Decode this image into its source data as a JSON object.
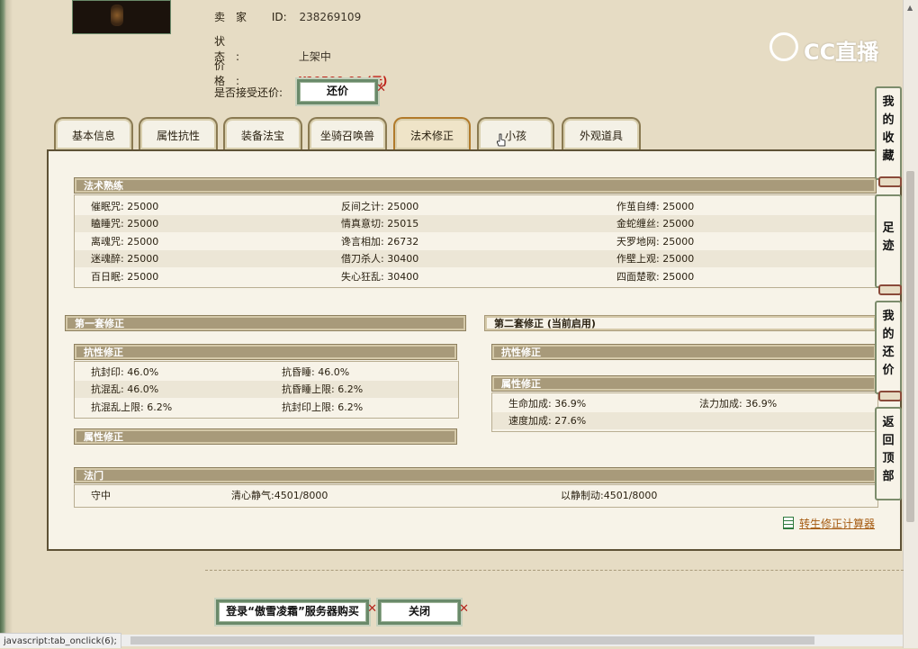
{
  "seller": {
    "seller_label": "卖家",
    "id_label": "ID:",
    "id_value": "238269109",
    "status_label": "状态:",
    "status_value": "上架中",
    "price_label": "价格:",
    "price_value": "¥19500.00 (元)",
    "counter_label": "是否接受还价:",
    "counter_button": "还价"
  },
  "logo": {
    "text": "CC直播"
  },
  "tabs": [
    {
      "label": "基本信息"
    },
    {
      "label": "属性抗性"
    },
    {
      "label": "装备法宝"
    },
    {
      "label": "坐骑召唤兽"
    },
    {
      "label": "法术修正"
    },
    {
      "label": "小孩"
    },
    {
      "label": "外观道具"
    }
  ],
  "spell_mastery": {
    "title": "法术熟练",
    "rows": [
      [
        "催眠咒: 25000",
        "反间之计: 25000",
        "作茧自缚: 25000"
      ],
      [
        "瞌睡咒: 25000",
        "情真意切: 25015",
        "金蛇缠丝: 25000"
      ],
      [
        "离魂咒: 25000",
        "谗言相加: 26732",
        "天罗地网: 25000"
      ],
      [
        "迷魂醉: 25000",
        "借刀杀人: 30400",
        "作壁上观: 25000"
      ],
      [
        "百日眠: 25000",
        "失心狂乱: 30400",
        "四面楚歌: 25000"
      ]
    ]
  },
  "set1": {
    "title": "第一套修正",
    "resist_title": "抗性修正",
    "resist_rows": [
      [
        "抗封印: 46.0%",
        "抗昏睡: 46.0%"
      ],
      [
        "抗混乱: 46.0%",
        "抗昏睡上限: 6.2%"
      ],
      [
        "抗混乱上限: 6.2%",
        "抗封印上限: 6.2%"
      ]
    ],
    "attr_title": "属性修正"
  },
  "set2": {
    "title": "第二套修正 (当前启用)",
    "resist_title": "抗性修正",
    "attr_title": "属性修正",
    "attr_rows": [
      [
        "生命加成: 36.9%",
        "法力加成: 36.9%"
      ],
      [
        "速度加成: 27.6%",
        ""
      ]
    ]
  },
  "fa_men": {
    "title": "法门",
    "row": [
      "守中",
      "清心静气:4501/8000",
      "以静制动:4501/8000"
    ]
  },
  "sidebar": {
    "favorites": "我的收藏",
    "footprints": "足迹",
    "my_counter": "我的还价",
    "back_top": "返回顶部"
  },
  "calculator_link": "转生修正计算器",
  "bottom": {
    "login_buy": "登录“傲雪凌霜”服务器购买",
    "close": "关闭"
  },
  "statusbar": "javascript:tab_onclick(6);",
  "colors": {
    "page_bg": "#e6dcc4",
    "panel_bg": "#f7f3e8",
    "section_head": "#a89a7a",
    "price_red": "#c0231a",
    "border_green": "#6a8a6a"
  }
}
